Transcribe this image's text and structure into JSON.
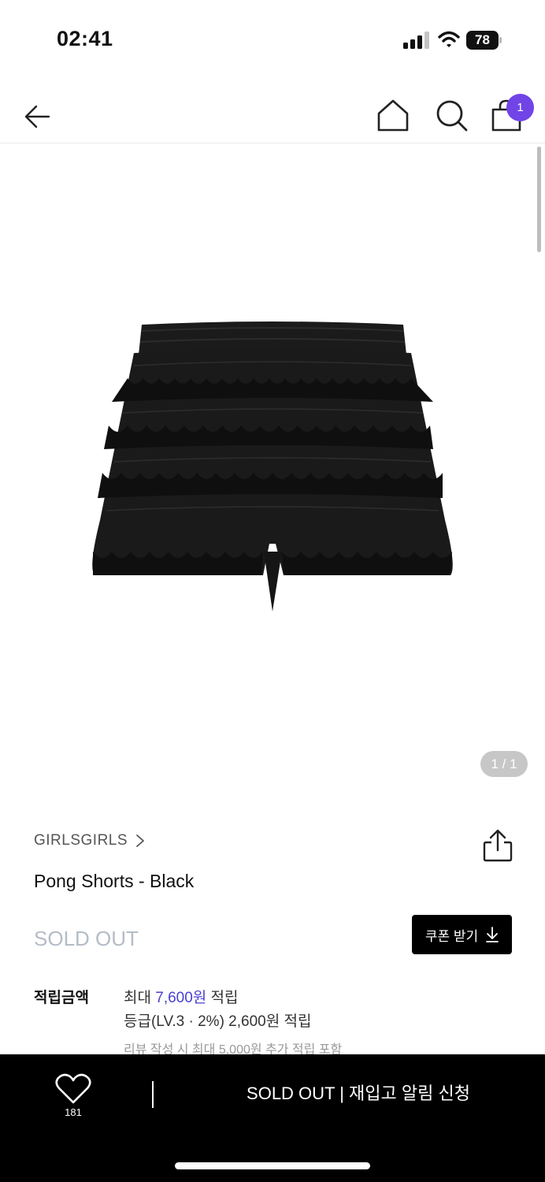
{
  "status_bar": {
    "time": "02:41",
    "battery": "78",
    "icons": [
      "signal-icon",
      "wifi-icon",
      "battery-icon"
    ]
  },
  "nav": {
    "icons": [
      "back-arrow-icon",
      "home-icon",
      "search-icon",
      "shopping-bag-icon"
    ],
    "cart_count": "1"
  },
  "gallery": {
    "counter": "1 / 1"
  },
  "product": {
    "brand": "GIRLSGIRLS",
    "title": "Pong Shorts - Black",
    "status": "SOLD OUT"
  },
  "coupon": {
    "label": "쿠폰 받기",
    "icon": "download-arrow-icon"
  },
  "points": {
    "label": "적립금액",
    "line1_prefix": "최대 ",
    "line1_amount": "7,600원",
    "line1_suffix": " 적립",
    "line2": "등급(LV.3 · 2%) 2,600원 적립",
    "note": "리뷰 작성 시 최대 5,000원 추가 적립 포함"
  },
  "bottom_bar": {
    "wishlist_count": "181",
    "restock_label": "SOLD OUT | 재입고 알림 신청"
  },
  "colors": {
    "accent": "#7044e6",
    "points_highlight": "#4a3fd1",
    "sold_out": "#b4bcc6",
    "bottom_bar": "#000000"
  }
}
